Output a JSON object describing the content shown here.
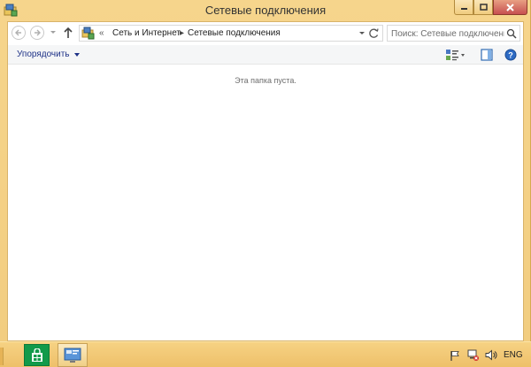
{
  "window": {
    "title": "Сетевые подключения"
  },
  "navigation": {
    "path_prefix": "«",
    "crumbs": [
      "Сеть и Интернет",
      "Сетевые подключения"
    ]
  },
  "search": {
    "placeholder": "Поиск: Сетевые подключения"
  },
  "commandbar": {
    "organize_label": "Упорядочить"
  },
  "content": {
    "empty_message": "Эта папка пуста."
  },
  "tray": {
    "language": "ENG"
  },
  "colors": {
    "frame": "#f2cd80",
    "link_blue": "#1e3287",
    "store_green": "#129a4a",
    "close_red": "#c75050"
  },
  "icons": [
    "network-folder-icon",
    "back-arrow-icon",
    "forward-arrow-icon",
    "up-arrow-icon",
    "refresh-icon",
    "search-icon",
    "view-options-icon",
    "preview-pane-icon",
    "help-icon",
    "store-icon",
    "explorer-icon",
    "flag-icon",
    "network-error-icon",
    "volume-icon"
  ]
}
